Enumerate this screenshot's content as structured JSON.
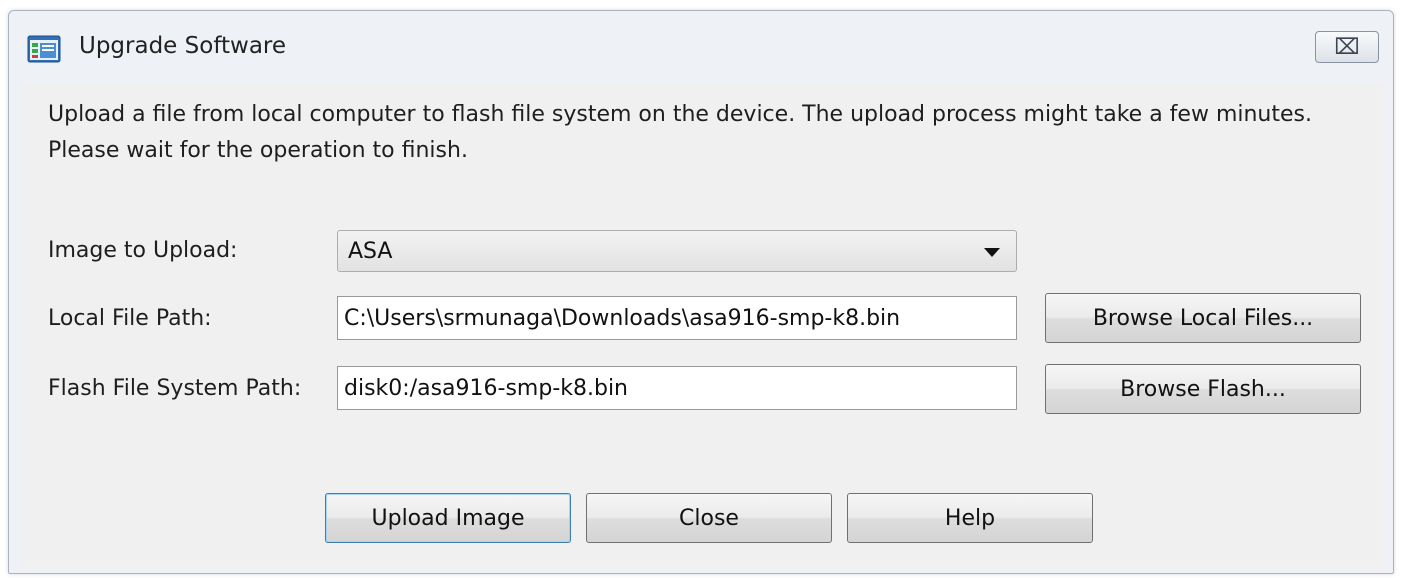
{
  "window": {
    "title": "Upgrade Software",
    "close_glyph": "⌧",
    "icon": "app-window-icon"
  },
  "dialog": {
    "description": "Upload a file from local computer to flash file system on the device. The upload process might take a few minutes. Please wait for the operation to finish."
  },
  "form": {
    "image_label": "Image to Upload:",
    "image_value": "ASA",
    "local_path_label": "Local File Path:",
    "local_path_value": "C:\\Users\\srmunaga\\Downloads\\asa916-smp-k8.bin",
    "flash_path_label": "Flash File System Path:",
    "flash_path_value": "disk0:/asa916-smp-k8.bin",
    "browse_local_label": "Browse Local Files...",
    "browse_flash_label": "Browse Flash..."
  },
  "buttons": {
    "upload": "Upload Image",
    "close": "Close",
    "help": "Help"
  },
  "colors": {
    "default_button_border": "#3c7fb1",
    "window_background": "#eef2f7",
    "client_background": "#f0f0f0"
  }
}
